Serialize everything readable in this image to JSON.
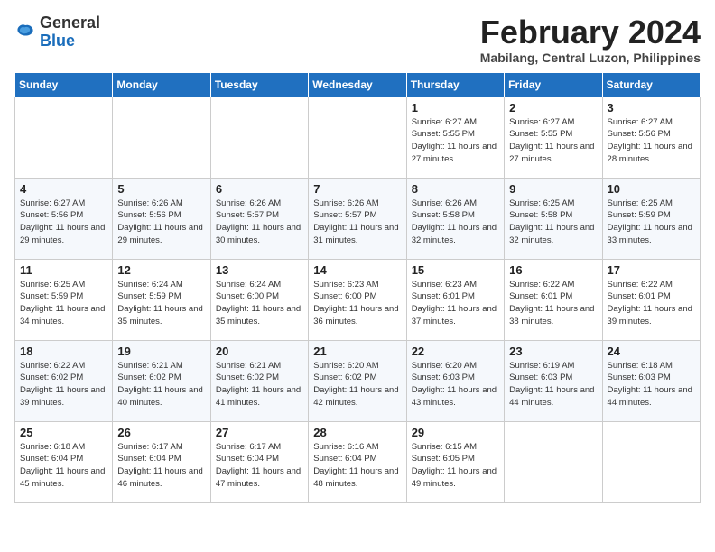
{
  "header": {
    "logo_general": "General",
    "logo_blue": "Blue",
    "month_year": "February 2024",
    "location": "Mabilang, Central Luzon, Philippines"
  },
  "days_of_week": [
    "Sunday",
    "Monday",
    "Tuesday",
    "Wednesday",
    "Thursday",
    "Friday",
    "Saturday"
  ],
  "weeks": [
    [
      {
        "day": "",
        "info": ""
      },
      {
        "day": "",
        "info": ""
      },
      {
        "day": "",
        "info": ""
      },
      {
        "day": "",
        "info": ""
      },
      {
        "day": "1",
        "info": "Sunrise: 6:27 AM\nSunset: 5:55 PM\nDaylight: 11 hours\nand 27 minutes."
      },
      {
        "day": "2",
        "info": "Sunrise: 6:27 AM\nSunset: 5:55 PM\nDaylight: 11 hours\nand 27 minutes."
      },
      {
        "day": "3",
        "info": "Sunrise: 6:27 AM\nSunset: 5:56 PM\nDaylight: 11 hours\nand 28 minutes."
      }
    ],
    [
      {
        "day": "4",
        "info": "Sunrise: 6:27 AM\nSunset: 5:56 PM\nDaylight: 11 hours\nand 29 minutes."
      },
      {
        "day": "5",
        "info": "Sunrise: 6:26 AM\nSunset: 5:56 PM\nDaylight: 11 hours\nand 29 minutes."
      },
      {
        "day": "6",
        "info": "Sunrise: 6:26 AM\nSunset: 5:57 PM\nDaylight: 11 hours\nand 30 minutes."
      },
      {
        "day": "7",
        "info": "Sunrise: 6:26 AM\nSunset: 5:57 PM\nDaylight: 11 hours\nand 31 minutes."
      },
      {
        "day": "8",
        "info": "Sunrise: 6:26 AM\nSunset: 5:58 PM\nDaylight: 11 hours\nand 32 minutes."
      },
      {
        "day": "9",
        "info": "Sunrise: 6:25 AM\nSunset: 5:58 PM\nDaylight: 11 hours\nand 32 minutes."
      },
      {
        "day": "10",
        "info": "Sunrise: 6:25 AM\nSunset: 5:59 PM\nDaylight: 11 hours\nand 33 minutes."
      }
    ],
    [
      {
        "day": "11",
        "info": "Sunrise: 6:25 AM\nSunset: 5:59 PM\nDaylight: 11 hours\nand 34 minutes."
      },
      {
        "day": "12",
        "info": "Sunrise: 6:24 AM\nSunset: 5:59 PM\nDaylight: 11 hours\nand 35 minutes."
      },
      {
        "day": "13",
        "info": "Sunrise: 6:24 AM\nSunset: 6:00 PM\nDaylight: 11 hours\nand 35 minutes."
      },
      {
        "day": "14",
        "info": "Sunrise: 6:23 AM\nSunset: 6:00 PM\nDaylight: 11 hours\nand 36 minutes."
      },
      {
        "day": "15",
        "info": "Sunrise: 6:23 AM\nSunset: 6:01 PM\nDaylight: 11 hours\nand 37 minutes."
      },
      {
        "day": "16",
        "info": "Sunrise: 6:22 AM\nSunset: 6:01 PM\nDaylight: 11 hours\nand 38 minutes."
      },
      {
        "day": "17",
        "info": "Sunrise: 6:22 AM\nSunset: 6:01 PM\nDaylight: 11 hours\nand 39 minutes."
      }
    ],
    [
      {
        "day": "18",
        "info": "Sunrise: 6:22 AM\nSunset: 6:02 PM\nDaylight: 11 hours\nand 39 minutes."
      },
      {
        "day": "19",
        "info": "Sunrise: 6:21 AM\nSunset: 6:02 PM\nDaylight: 11 hours\nand 40 minutes."
      },
      {
        "day": "20",
        "info": "Sunrise: 6:21 AM\nSunset: 6:02 PM\nDaylight: 11 hours\nand 41 minutes."
      },
      {
        "day": "21",
        "info": "Sunrise: 6:20 AM\nSunset: 6:02 PM\nDaylight: 11 hours\nand 42 minutes."
      },
      {
        "day": "22",
        "info": "Sunrise: 6:20 AM\nSunset: 6:03 PM\nDaylight: 11 hours\nand 43 minutes."
      },
      {
        "day": "23",
        "info": "Sunrise: 6:19 AM\nSunset: 6:03 PM\nDaylight: 11 hours\nand 44 minutes."
      },
      {
        "day": "24",
        "info": "Sunrise: 6:18 AM\nSunset: 6:03 PM\nDaylight: 11 hours\nand 44 minutes."
      }
    ],
    [
      {
        "day": "25",
        "info": "Sunrise: 6:18 AM\nSunset: 6:04 PM\nDaylight: 11 hours\nand 45 minutes."
      },
      {
        "day": "26",
        "info": "Sunrise: 6:17 AM\nSunset: 6:04 PM\nDaylight: 11 hours\nand 46 minutes."
      },
      {
        "day": "27",
        "info": "Sunrise: 6:17 AM\nSunset: 6:04 PM\nDaylight: 11 hours\nand 47 minutes."
      },
      {
        "day": "28",
        "info": "Sunrise: 6:16 AM\nSunset: 6:04 PM\nDaylight: 11 hours\nand 48 minutes."
      },
      {
        "day": "29",
        "info": "Sunrise: 6:15 AM\nSunset: 6:05 PM\nDaylight: 11 hours\nand 49 minutes."
      },
      {
        "day": "",
        "info": ""
      },
      {
        "day": "",
        "info": ""
      }
    ]
  ]
}
